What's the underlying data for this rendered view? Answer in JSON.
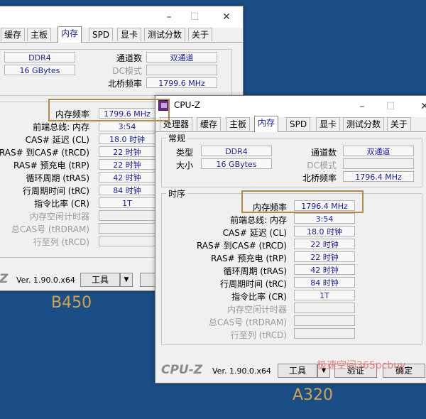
{
  "colors": {
    "background": "#1b4e86",
    "highlight": "#b08a4a",
    "value_text": "#1a1aa0",
    "caption": "#d4a24c"
  },
  "left": {
    "tabs": [
      "缓存",
      "主板",
      "内存",
      "SPD",
      "显卡",
      "测试分数",
      "关于"
    ],
    "active_tab": "内存",
    "general": {
      "type_value": "DDR4",
      "size_value": "16 GBytes",
      "channels_label": "通道数",
      "channels_value": "双通道",
      "dc_label": "DC模式",
      "nb_label": "北桥频率",
      "nb_value": "1799.6 MHz"
    },
    "timings": [
      {
        "label": "内存频率",
        "value": "1799.6 MHz"
      },
      {
        "label": "前端总线: 内存",
        "value": "3:54"
      },
      {
        "label": "CAS# 延迟 (CL)",
        "value": "18.0 时钟"
      },
      {
        "label": "RAS# 到CAS# (tRCD)",
        "value": "22 时钟"
      },
      {
        "label": "RAS# 预充电 (tRP)",
        "value": "22 时钟"
      },
      {
        "label": "循环周期 (tRAS)",
        "value": "42 时钟"
      },
      {
        "label": "行周期时间 (tRC)",
        "value": "84 时钟"
      },
      {
        "label": "指令比率 (CR)",
        "value": "1T"
      },
      {
        "label": "内存空闲计时器",
        "value": ""
      },
      {
        "label": "总CAS号 (tRDRAM)",
        "value": ""
      },
      {
        "label": "行至列 (tRCD)",
        "value": ""
      }
    ],
    "logo_fragment": "Z",
    "version": "Ver. 1.90.0.x64",
    "tools_label": "工具",
    "next_btn_fragment": "验",
    "caption": "B450"
  },
  "right": {
    "title": "CPU-Z",
    "tabs": [
      "处理器",
      "缓存",
      "主板",
      "内存",
      "SPD",
      "显卡",
      "测试分数",
      "关于"
    ],
    "active_tab": "内存",
    "general_title": "常规",
    "type_label": "类型",
    "type_value": "DDR4",
    "size_label": "大小",
    "size_value": "16 GBytes",
    "channels_label": "通道数",
    "channels_value": "双通道",
    "dc_label": "DC模式",
    "nb_label": "北桥频率",
    "nb_value": "1796.4 MHz",
    "timings_title": "时序",
    "timings": [
      {
        "label": "内存频率",
        "value": "1796.4 MHz"
      },
      {
        "label": "前端总线: 内存",
        "value": "3:54"
      },
      {
        "label": "CAS# 延迟 (CL)",
        "value": "18.0 时钟"
      },
      {
        "label": "RAS# 到CAS# (tRCD)",
        "value": "22 时钟"
      },
      {
        "label": "RAS# 预充电 (tRP)",
        "value": "22 时钟"
      },
      {
        "label": "循环周期 (tRAS)",
        "value": "42 时钟"
      },
      {
        "label": "行周期时间 (tRC)",
        "value": "84 时钟"
      },
      {
        "label": "指令比率 (CR)",
        "value": "1T"
      },
      {
        "label": "内存空闲计时器",
        "value": ""
      },
      {
        "label": "总CAS号 (tRDRAM)",
        "value": ""
      },
      {
        "label": "行至列 (tRCD)",
        "value": ""
      }
    ],
    "logo": "CPU-Z",
    "version": "Ver. 1.90.0.x64",
    "tools_label": "工具",
    "validate_label": "验证",
    "ok_label": "确定",
    "caption": "A320"
  },
  "watermark": "极速空间365pcbuy"
}
